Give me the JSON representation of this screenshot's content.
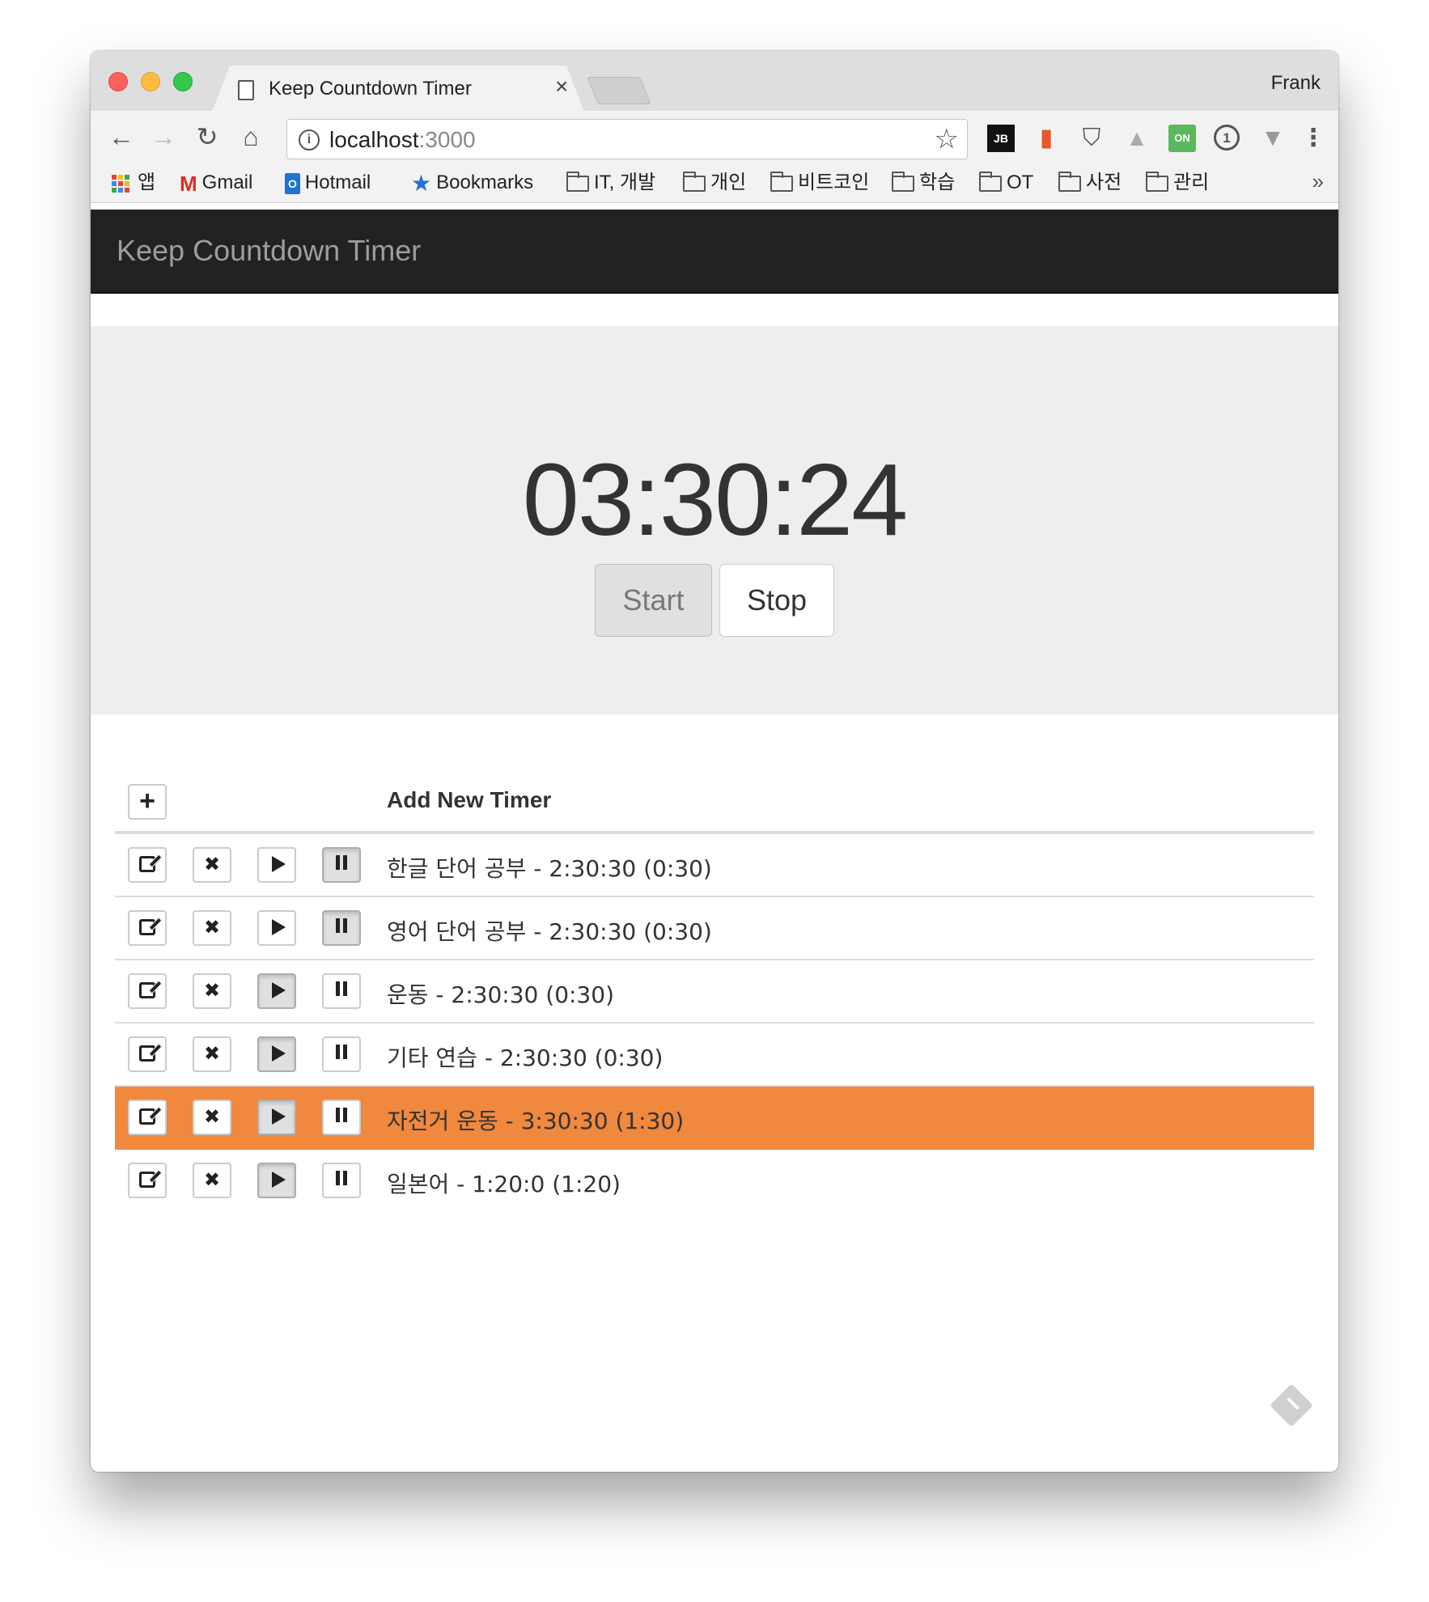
{
  "browser": {
    "tab_title": "Keep Countdown Timer",
    "tab_close": "×",
    "profile_name": "Frank",
    "url_host": "localhost",
    "url_port": ":3000",
    "nav": {
      "back": "←",
      "forward": "→",
      "reload": "↻",
      "home": "⌂"
    },
    "extensions": [
      {
        "name": "jetbrains-icon",
        "glyph": "JB"
      },
      {
        "name": "office-icon",
        "glyph": "▮"
      },
      {
        "name": "pocket-icon",
        "glyph": "⛉"
      },
      {
        "name": "drive-icon",
        "glyph": "▲"
      },
      {
        "name": "on-extension-icon",
        "glyph": "ON"
      },
      {
        "name": "onepassword-icon",
        "glyph": "1"
      },
      {
        "name": "vue-devtools-icon",
        "glyph": "▼"
      },
      {
        "name": "menu-icon",
        "glyph": "⋮"
      }
    ],
    "bookmarks": {
      "apps": "앱",
      "gmail": "Gmail",
      "hotmail": "Hotmail",
      "bookmarks": "Bookmarks",
      "folders": [
        "IT, 개발",
        "개인",
        "비트코인",
        "학습",
        "OT",
        "사전",
        "관리"
      ],
      "more": "»"
    },
    "apps_colors": [
      "#ea4335",
      "#fbbc05",
      "#34a853",
      "#4285f4",
      "#ea4335",
      "#fbbc05",
      "#34a853",
      "#4285f4",
      "#ea4335"
    ]
  },
  "app": {
    "brand": "Keep Countdown Timer",
    "clock": "03:30:24",
    "start_label": "Start",
    "stop_label": "Stop",
    "add_label": "Add New Timer",
    "accent_color": "#f0883e",
    "timers": [
      {
        "label": "한글 단어 공부 - 2:30:30 (0:30)",
        "play_pressed": false,
        "pause_pressed": true,
        "active": false
      },
      {
        "label": "영어 단어 공부 - 2:30:30 (0:30)",
        "play_pressed": false,
        "pause_pressed": true,
        "active": false
      },
      {
        "label": "운동 - 2:30:30 (0:30)",
        "play_pressed": true,
        "pause_pressed": false,
        "active": false
      },
      {
        "label": "기타 연습 - 2:30:30 (0:30)",
        "play_pressed": true,
        "pause_pressed": false,
        "active": false
      },
      {
        "label": "자전거 운동 - 3:30:30 (1:30)",
        "play_pressed": true,
        "pause_pressed": false,
        "active": true
      },
      {
        "label": "일본어 - 1:20:0 (1:20)",
        "play_pressed": true,
        "pause_pressed": false,
        "active": false
      }
    ]
  }
}
